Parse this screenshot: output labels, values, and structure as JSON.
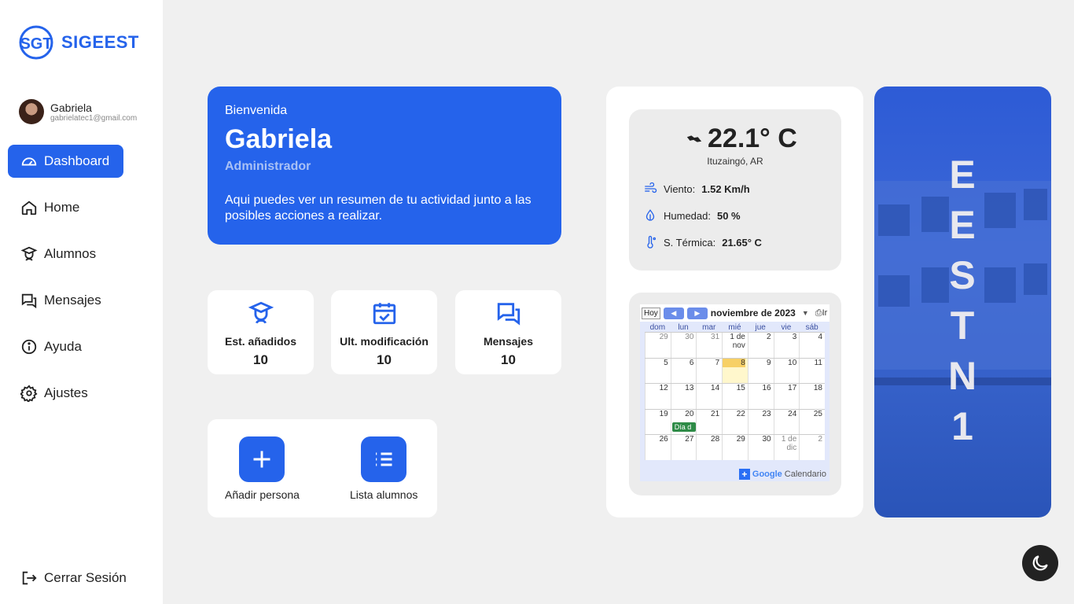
{
  "brand": {
    "name": "SIGEEST",
    "logo_text": "SGT"
  },
  "user": {
    "name": "Gabriela",
    "email": "gabrielatec1@gmail.com"
  },
  "nav": [
    {
      "label": "Dashboard",
      "icon": "gauge-icon",
      "active": true
    },
    {
      "label": "Home",
      "icon": "home-icon"
    },
    {
      "label": "Alumnos",
      "icon": "student-icon"
    },
    {
      "label": "Mensajes",
      "icon": "chat-icon"
    },
    {
      "label": "Ayuda",
      "icon": "info-icon"
    },
    {
      "label": "Ajustes",
      "icon": "gear-icon"
    }
  ],
  "logout_label": "Cerrar Sesión",
  "welcome": {
    "greeting": "Bienvenida",
    "name": "Gabriela",
    "role": "Administrador",
    "description": "Aqui puedes ver un resumen de tu actividad junto a las posibles acciones a realizar."
  },
  "stats": [
    {
      "label": "Est. añadidos",
      "value": "10",
      "icon": "student-icon"
    },
    {
      "label": "Ult. modificación",
      "value": "10",
      "icon": "calendar-check-icon"
    },
    {
      "label": "Mensajes",
      "value": "10",
      "icon": "chat-icon"
    }
  ],
  "actions": [
    {
      "label": "Añadir persona",
      "icon": "plus-icon"
    },
    {
      "label": "Lista alumnos",
      "icon": "list-icon"
    }
  ],
  "weather": {
    "temperature": "22.1° C",
    "location": "Ituzaingó, AR",
    "wind_label": "Viento:",
    "wind_value": "1.52 Km/h",
    "humidity_label": "Humedad:",
    "humidity_value": "50 %",
    "feels_label": "S. Térmica:",
    "feels_value": "21.65° C"
  },
  "calendar": {
    "today_button": "Hoy",
    "month": "noviembre de 2023",
    "print_label": "Ir",
    "weekdays": [
      "dom",
      "lun",
      "mar",
      "mié",
      "jue",
      "vie",
      "sáb"
    ],
    "weeks": [
      [
        "29",
        "30",
        "31",
        "1 de nov",
        "2",
        "3",
        "4"
      ],
      [
        "5",
        "6",
        "7",
        "8",
        "9",
        "10",
        "11"
      ],
      [
        "12",
        "13",
        "14",
        "15",
        "16",
        "17",
        "18"
      ],
      [
        "19",
        "20",
        "21",
        "22",
        "23",
        "24",
        "25"
      ],
      [
        "26",
        "27",
        "28",
        "29",
        "30",
        "1 de dic",
        "2"
      ]
    ],
    "event": "Día d",
    "footer_brand": "Google",
    "footer_text": "Calendario"
  },
  "photo_caption": [
    "E",
    "E",
    "S",
    "T",
    "N",
    "1"
  ],
  "colors": {
    "accent": "#2563eb",
    "background": "#f0f0f0"
  }
}
